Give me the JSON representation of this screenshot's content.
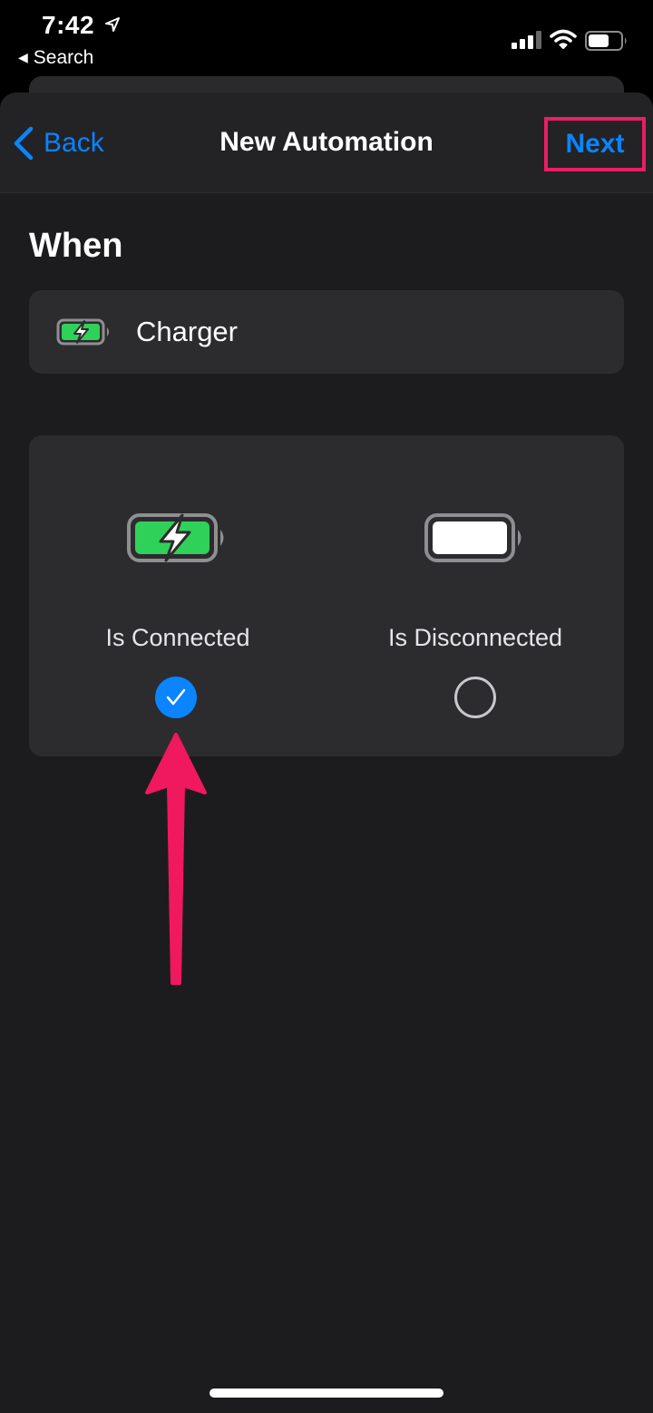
{
  "status_bar": {
    "time": "7:42",
    "back_app": "Search"
  },
  "navbar": {
    "back_label": "Back",
    "title": "New Automation",
    "next_label": "Next"
  },
  "when_heading": "When",
  "trigger": {
    "label": "Charger",
    "icon": "battery-charging-icon"
  },
  "options": [
    {
      "label": "Is Connected",
      "icon": "battery-charging-icon",
      "selected": true
    },
    {
      "label": "Is Disconnected",
      "icon": "battery-full-icon",
      "selected": false
    }
  ],
  "colors": {
    "accent": "#0a84ff",
    "highlight": "#e91e63",
    "charging_green": "#30d158",
    "background": "#1c1c1e",
    "card": "#2c2c2e"
  }
}
